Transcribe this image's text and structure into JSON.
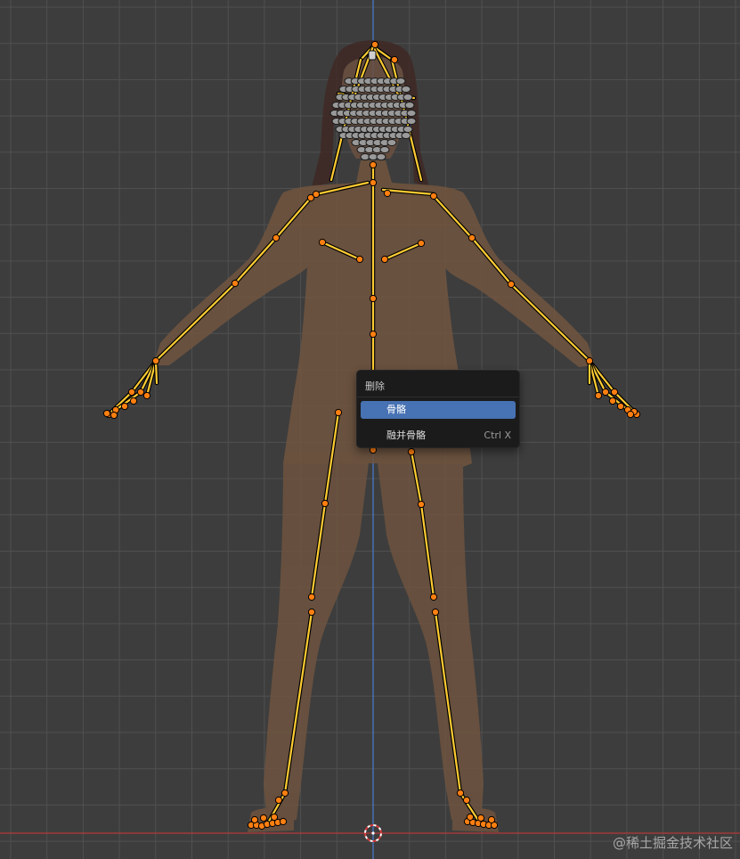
{
  "viewport": {
    "background": "#3d3d3d",
    "grid_color": "#505050",
    "x_axis_color": "#b23a3a",
    "z_axis_color": "#4b7bd0",
    "bone_color": "#ffcc33",
    "joint_color": "#ff7f11",
    "mesh_color": "#7a6048"
  },
  "context_menu": {
    "title": "删除",
    "items": [
      {
        "label": "骨骼",
        "shortcut": "",
        "highlighted": true
      },
      {
        "label": "融并骨骼",
        "shortcut": "Ctrl X",
        "highlighted": false
      }
    ]
  },
  "watermark": "@稀土掘金技术社区",
  "icons": [
    "3d-cursor-icon"
  ]
}
